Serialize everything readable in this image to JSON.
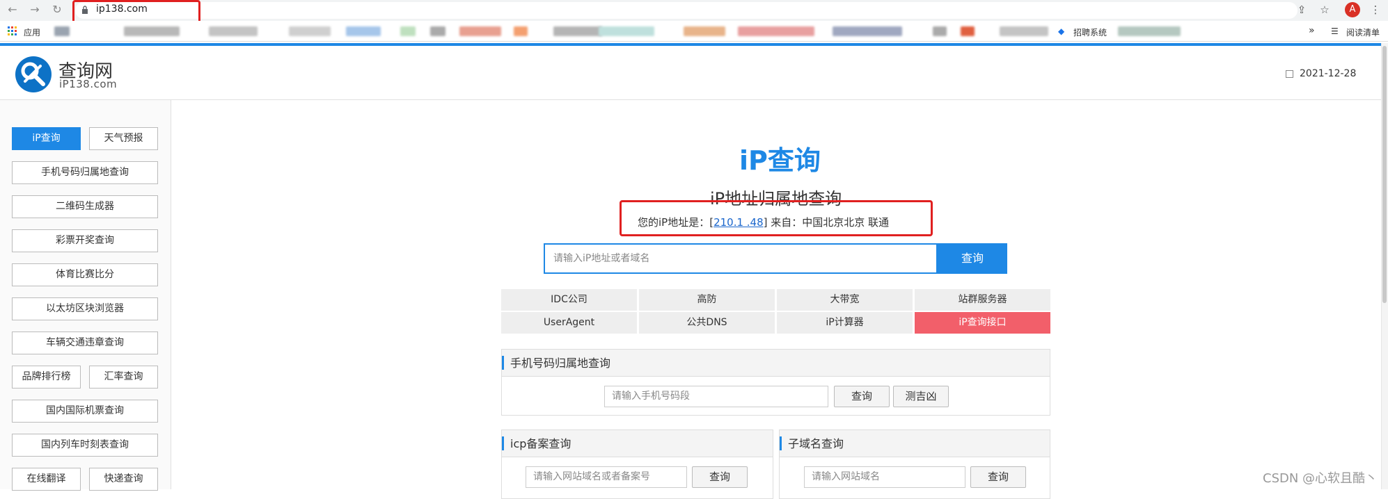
{
  "browser": {
    "url": "ip138.com",
    "avatar_letter": "A",
    "bookmarks_apps": "应用",
    "bookmarks_recruit": "招聘系统",
    "bookmarks_reading": "阅读清单",
    "more": "»"
  },
  "header": {
    "logo_title": "查询网",
    "logo_sub": "iP138.com",
    "date": "2021-12-28"
  },
  "sidebar": {
    "ip_query": "iP查询",
    "weather": "天气预报",
    "phone": "手机号码归属地查询",
    "qrcode": "二维码生成器",
    "lottery": "彩票开奖查询",
    "sports": "体育比赛比分",
    "eth": "以太坊区块浏览器",
    "traffic": "车辆交通违章查询",
    "brand": "品牌排行榜",
    "exchange": "汇率查询",
    "flight": "国内国际机票查询",
    "train": "国内列车时刻表查询",
    "translate": "在线翻译",
    "express": "快递查询"
  },
  "main": {
    "title": "iP查询",
    "subtitle": "iP地址归属地查询",
    "ip_prefix": "您的iP地址是：[",
    "ip_value": "210.1 .48",
    "ip_suffix": "] 来自：中国北京北京 联通",
    "search_placeholder": "请输入iP地址或者域名",
    "search_button": "查询"
  },
  "grid": {
    "idc": "IDC公司",
    "gaofang": "高防",
    "bandwidth": "大带宽",
    "station": "站群服务器",
    "useragent": "UserAgent",
    "dns": "公共DNS",
    "calc": "iP计算器",
    "api": "iP查询接口"
  },
  "phone_panel": {
    "title": "手机号码归属地查询",
    "placeholder": "请输入手机号码段",
    "query": "查询",
    "luck": "测吉凶"
  },
  "icp_panel": {
    "title": "icp备案查询",
    "placeholder": "请输入网站域名或者备案号",
    "query": "查询"
  },
  "subdomain_panel": {
    "title": "子域名查询",
    "placeholder": "请输入网站域名",
    "query": "查询"
  },
  "watermark": "CSDN @心软且酷丶",
  "colors": {
    "accent": "#1e88e5",
    "hot": "#f25f6a",
    "annotation": "#e02020"
  }
}
